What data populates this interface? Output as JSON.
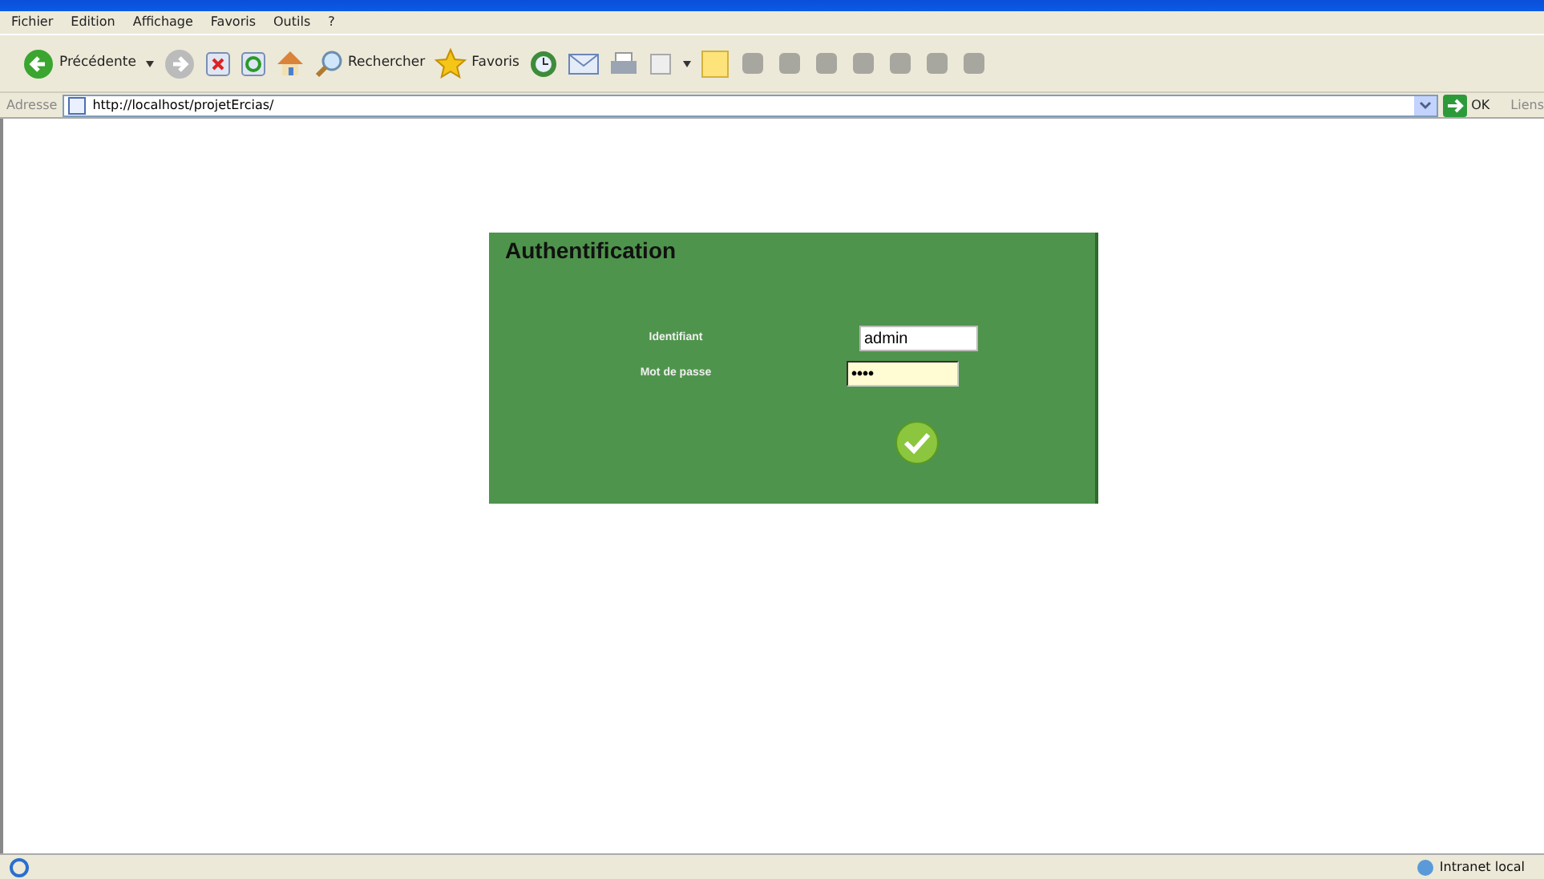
{
  "menu": [
    "Fichier",
    "Edition",
    "Affichage",
    "Favoris",
    "Outils",
    "?"
  ],
  "toolbar": {
    "back": "Précédente",
    "search": "Rechercher",
    "favorites": "Favoris"
  },
  "address": {
    "label": "Adresse",
    "url": "http://localhost/projetErcias/",
    "go": "OK",
    "links": "Liens"
  },
  "login": {
    "title": "Authentification",
    "fields": [
      {
        "label": "Identifiant",
        "value": "admin",
        "kind": "text"
      },
      {
        "label": "Mot de passe",
        "value": "••••",
        "kind": "password"
      }
    ]
  },
  "status_bar": {
    "zone": "Intranet local"
  }
}
